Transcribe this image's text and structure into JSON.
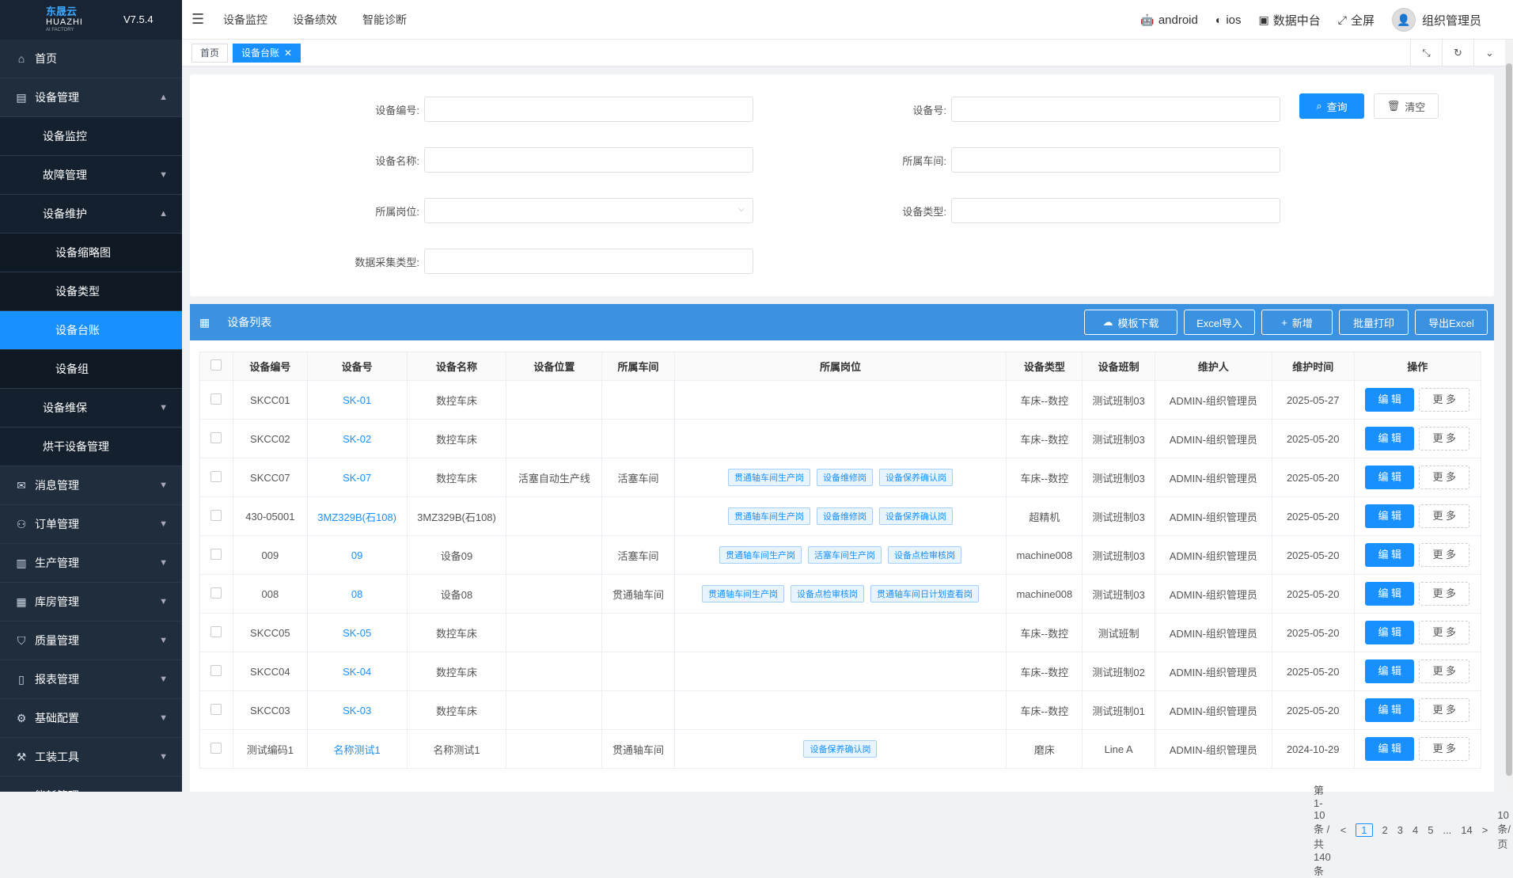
{
  "brand": {
    "logo_cn": "东晟云",
    "logo_en": "HUAZHI",
    "logo_sub": "AI FACTORY",
    "version": "V7.5.4"
  },
  "sidebar": {
    "items": [
      {
        "label": "首页",
        "icon": "home-icon",
        "level": 1
      },
      {
        "label": "设备管理",
        "icon": "device-icon",
        "level": 1,
        "chev": "▲"
      },
      {
        "label": "设备监控",
        "level": 2
      },
      {
        "label": "故障管理",
        "level": 2,
        "chev": "▼"
      },
      {
        "label": "设备维护",
        "level": 2,
        "chev": "▲"
      },
      {
        "label": "设备缩略图",
        "level": 3
      },
      {
        "label": "设备类型",
        "level": 3
      },
      {
        "label": "设备台账",
        "level": 3,
        "active": true
      },
      {
        "label": "设备组",
        "level": 3
      },
      {
        "label": "设备维保",
        "level": 2,
        "chev": "▼"
      },
      {
        "label": "烘干设备管理",
        "level": 2
      },
      {
        "label": "消息管理",
        "icon": "message-icon",
        "level": 1,
        "chev": "▼"
      },
      {
        "label": "订单管理",
        "icon": "order-icon",
        "level": 1,
        "chev": "▼"
      },
      {
        "label": "生产管理",
        "icon": "production-icon",
        "level": 1,
        "chev": "▼"
      },
      {
        "label": "库房管理",
        "icon": "warehouse-icon",
        "level": 1,
        "chev": "▼"
      },
      {
        "label": "质量管理",
        "icon": "quality-icon",
        "level": 1,
        "chev": "▼"
      },
      {
        "label": "报表管理",
        "icon": "report-icon",
        "level": 1,
        "chev": "▼"
      },
      {
        "label": "基础配置",
        "icon": "settings-icon",
        "level": 1,
        "chev": "▼"
      },
      {
        "label": "工装工具",
        "icon": "tool-icon",
        "level": 1,
        "chev": "▼"
      },
      {
        "label": "能耗管理",
        "icon": "energy-icon",
        "level": 1,
        "chev": "▼"
      }
    ]
  },
  "topbar": {
    "nav": [
      "设备监控",
      "设备绩效",
      "智能诊断"
    ],
    "android": "android",
    "ios": "ios",
    "datacenter": "数据中台",
    "fullscreen": "全屏",
    "user": "组织管理员"
  },
  "tabs": {
    "home": "首页",
    "current": "设备台账"
  },
  "search": {
    "device_code": "设备编号:",
    "device_no": "设备号:",
    "device_name": "设备名称:",
    "workshop": "所属车间:",
    "post": "所属岗位:",
    "device_type": "设备类型:",
    "collect_type": "数据采集类型:",
    "query": "查询",
    "clear": "清空"
  },
  "list": {
    "title": "设备列表",
    "buttons": [
      "模板下载",
      "Excel导入",
      "新增",
      "批量打印",
      "导出Excel"
    ],
    "columns": [
      "设备编号",
      "设备号",
      "设备名称",
      "设备位置",
      "所属车间",
      "所属岗位",
      "设备类型",
      "设备班制",
      "维护人",
      "维护时间",
      "操作"
    ],
    "edit": "编 辑",
    "more": "更 多",
    "rows": [
      {
        "code": "SKCC01",
        "no": "SK-01",
        "name": "数控车床",
        "loc": "",
        "shop": "",
        "posts": [],
        "type": "车床--数控",
        "shift": "测试班制03",
        "maint": "ADMIN-组织管理员",
        "time": "2025-05-27"
      },
      {
        "code": "SKCC02",
        "no": "SK-02",
        "name": "数控车床",
        "loc": "",
        "shop": "",
        "posts": [],
        "type": "车床--数控",
        "shift": "测试班制03",
        "maint": "ADMIN-组织管理员",
        "time": "2025-05-20"
      },
      {
        "code": "SKCC07",
        "no": "SK-07",
        "name": "数控车床",
        "loc": "活塞自动生产线",
        "shop": "活塞车间",
        "posts": [
          "贯通轴车间生产岗",
          "设备维修岗",
          "设备保养确认岗"
        ],
        "type": "车床--数控",
        "shift": "测试班制03",
        "maint": "ADMIN-组织管理员",
        "time": "2025-05-20"
      },
      {
        "code": "430-05001",
        "no": "3MZ329B(石108)",
        "name": "3MZ329B(石108)",
        "loc": "",
        "shop": "",
        "posts": [
          "贯通轴车间生产岗",
          "设备维修岗",
          "设备保养确认岗"
        ],
        "type": "超精机",
        "shift": "测试班制03",
        "maint": "ADMIN-组织管理员",
        "time": "2025-05-20"
      },
      {
        "code": "009",
        "no": "09",
        "name": "设备09",
        "loc": "",
        "shop": "活塞车间",
        "posts": [
          "贯通轴车间生产岗",
          "活塞车间生产岗",
          "设备点检审核岗"
        ],
        "type": "machine008",
        "shift": "测试班制03",
        "maint": "ADMIN-组织管理员",
        "time": "2025-05-20"
      },
      {
        "code": "008",
        "no": "08",
        "name": "设备08",
        "loc": "",
        "shop": "贯通轴车间",
        "posts": [
          "贯通轴车间生产岗",
          "设备点检审核岗",
          "贯通轴车间日计划查看岗"
        ],
        "type": "machine008",
        "shift": "测试班制03",
        "maint": "ADMIN-组织管理员",
        "time": "2025-05-20"
      },
      {
        "code": "SKCC05",
        "no": "SK-05",
        "name": "数控车床",
        "loc": "",
        "shop": "",
        "posts": [],
        "type": "车床--数控",
        "shift": "测试班制",
        "maint": "ADMIN-组织管理员",
        "time": "2025-05-20"
      },
      {
        "code": "SKCC04",
        "no": "SK-04",
        "name": "数控车床",
        "loc": "",
        "shop": "",
        "posts": [],
        "type": "车床--数控",
        "shift": "测试班制02",
        "maint": "ADMIN-组织管理员",
        "time": "2025-05-20"
      },
      {
        "code": "SKCC03",
        "no": "SK-03",
        "name": "数控车床",
        "loc": "",
        "shop": "",
        "posts": [],
        "type": "车床--数控",
        "shift": "测试班制01",
        "maint": "ADMIN-组织管理员",
        "time": "2025-05-20"
      },
      {
        "code": "测试编码1",
        "no": "名称测试1",
        "name": "名称测试1",
        "loc": "",
        "shop": "贯通轴车间",
        "posts": [
          "设备保养确认岗"
        ],
        "type": "磨床",
        "shift": "Line A",
        "maint": "ADMIN-组织管理员",
        "time": "2024-10-29"
      }
    ]
  },
  "pager": {
    "total": "第1-10条 / 共140条",
    "pages": [
      "<",
      "1",
      "2",
      "3",
      "4",
      "5",
      "...",
      "14",
      ">"
    ],
    "size": "10 条/页"
  }
}
